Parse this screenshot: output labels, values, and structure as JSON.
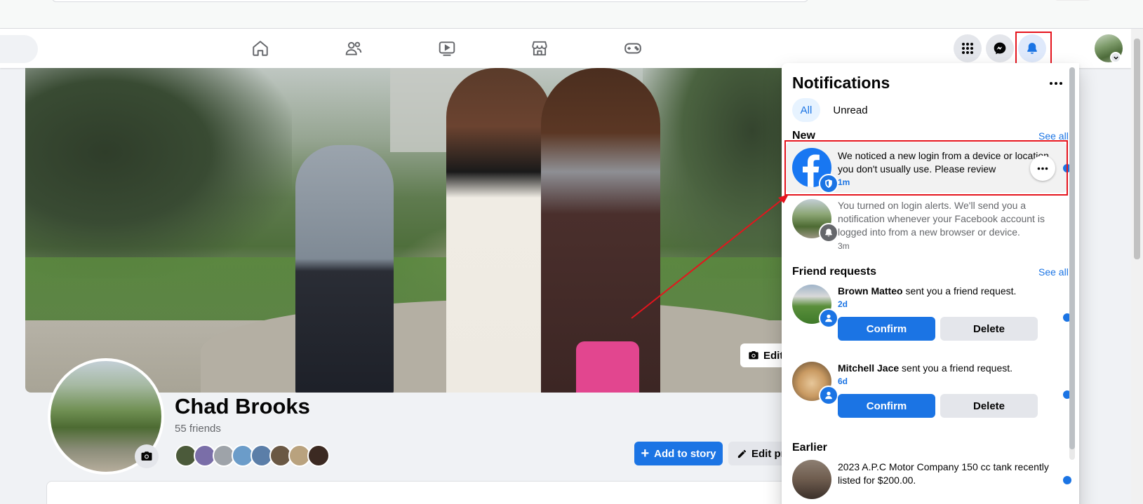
{
  "profile": {
    "name": "Chad Brooks",
    "friends_count": "55 friends",
    "add_to_story_label": "Add to story",
    "edit_profile_label": "Edit pr",
    "edit_cover_label": "Edit",
    "friend_avatar_colors": [
      "#4b5a3a",
      "#7a6ea8",
      "#9ea3a9",
      "#6b9cc9",
      "#5b7ea8",
      "#6a5844",
      "#b9a27e",
      "#3c2a22"
    ]
  },
  "nav": {
    "icons": [
      "home-icon",
      "friends-icon",
      "watch-icon",
      "marketplace-icon",
      "gaming-icon"
    ],
    "right_buttons": [
      "menu-grid-icon",
      "messenger-icon",
      "notifications-bell-icon"
    ]
  },
  "notifications": {
    "title": "Notifications",
    "tabs": {
      "all": "All",
      "unread": "Unread"
    },
    "sections": {
      "new": "New",
      "friend_requests": "Friend requests",
      "earlier": "Earlier",
      "see_all": "See all"
    },
    "items": [
      {
        "text": "We noticed a new login from a device or location you don't usually use. Please review",
        "time": "1m"
      },
      {
        "text": "You turned on login alerts. We'll send you a notification whenever your Facebook account is logged into from a new browser or device.",
        "time": "3m"
      }
    ],
    "friend_requests": [
      {
        "name": "Brown Matteo",
        "action": " sent you a friend request.",
        "time": "2d",
        "confirm": "Confirm",
        "delete": "Delete"
      },
      {
        "name": "Mitchell Jace",
        "action": " sent you a friend request.",
        "time": "6d",
        "confirm": "Confirm",
        "delete": "Delete"
      }
    ],
    "earlier": [
      {
        "text": "2023 A.P.C Motor Company 150 cc tank recently listed for $200.00."
      }
    ]
  },
  "colors": {
    "accent": "#1b74e4",
    "annotation": "#e5141d",
    "unread_bg": "#e7f3ff"
  }
}
